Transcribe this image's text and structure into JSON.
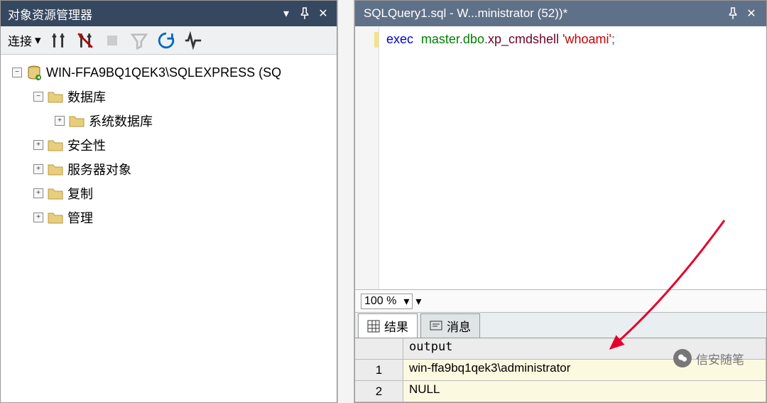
{
  "leftPanel": {
    "title": "对象资源管理器",
    "connectLabel": "连接",
    "tree": {
      "server": "WIN-FFA9BQ1QEK3\\SQLEXPRESS (SQ",
      "databases": "数据库",
      "systemDatabases": "系统数据库",
      "security": "安全性",
      "serverObjects": "服务器对象",
      "replication": "复制",
      "management": "管理"
    }
  },
  "rightPanel": {
    "docTitle": "SQLQuery1.sql - W...ministrator (52))*",
    "sql": {
      "exec": "exec",
      "master": "master",
      "dot1": ".",
      "dbo": "dbo",
      "dot2": ".",
      "xp": "xp_cmdshell",
      "argOpen": " '",
      "arg": "whoami",
      "argClose": "'",
      "semicolon": ";"
    },
    "zoom": "100 %",
    "tabs": {
      "results": "结果",
      "messages": "消息"
    },
    "grid": {
      "col": "output",
      "rows": [
        {
          "n": "1",
          "v": "win-ffa9bq1qek3\\administrator"
        },
        {
          "n": "2",
          "v": "NULL"
        }
      ]
    }
  },
  "watermark": "信安随笔"
}
